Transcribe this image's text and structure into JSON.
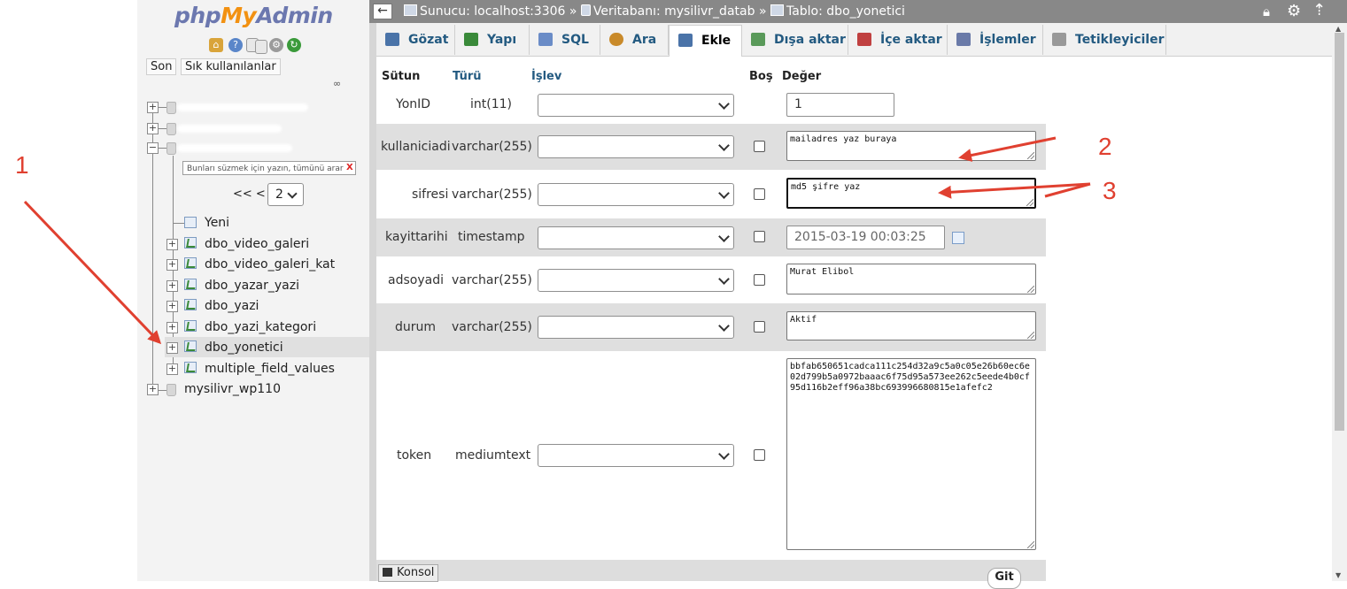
{
  "app": {
    "logo_php": "php",
    "logo_my": "My",
    "logo_admin": "Admin"
  },
  "nav": {
    "tabs": [
      "Son",
      "Sık kullanılanlar"
    ],
    "filter_placeholder": "Bunları süzmek için yazın, tümünü arar",
    "filter_clear": "X",
    "pager_prev": "<< <",
    "pager_page": "2",
    "tree_items": [
      "Yeni",
      "dbo_video_galeri",
      "dbo_video_galeri_kat",
      "dbo_yazar_yazi",
      "dbo_yazi",
      "dbo_yazi_kategori",
      "dbo_yonetici",
      "multiple_field_values"
    ],
    "db_bottom": "mysilivr_wp110"
  },
  "topbar": {
    "back": "←",
    "server": "Sunucu: localhost:3306",
    "database": "Veritabanı: mysilivr_datab",
    "table": "Tablo: dbo_yonetici",
    "sep": "»"
  },
  "tabs": [
    {
      "label": "Gözat",
      "icon": "browse-icon",
      "color": "#4a73a8"
    },
    {
      "label": "Yapı",
      "icon": "structure-icon",
      "color": "#3a8a3a"
    },
    {
      "label": "SQL",
      "icon": "sql-icon",
      "color": "#6a8cc7"
    },
    {
      "label": "Ara",
      "icon": "search-icon",
      "color": "#c98a2a"
    },
    {
      "label": "Ekle",
      "icon": "insert-icon",
      "color": "#4a73a8"
    },
    {
      "label": "Dışa aktar",
      "icon": "export-icon",
      "color": "#5a9a5a"
    },
    {
      "label": "İçe aktar",
      "icon": "import-icon",
      "color": "#c04040"
    },
    {
      "label": "İşlemler",
      "icon": "wrench-icon",
      "color": "#6a7aa8"
    },
    {
      "label": "Tetikleyiciler",
      "icon": "triggers-icon",
      "color": "#999999"
    }
  ],
  "table": {
    "headers": {
      "column": "Sütun",
      "type": "Türü",
      "function": "İşlev",
      "null": "Boş",
      "value": "Değer"
    },
    "rows": [
      {
        "name": "YonID",
        "type": "int(11)",
        "value": "1"
      },
      {
        "name": "kullaniciadi",
        "type": "varchar(255)",
        "value": "mailadres yaz buraya"
      },
      {
        "name": "sifresi",
        "type": "varchar(255)",
        "value": "md5 şifre yaz"
      },
      {
        "name": "kayittarihi",
        "type": "timestamp",
        "value": "2015-03-19 00:03:25"
      },
      {
        "name": "adsoyadi",
        "type": "varchar(255)",
        "value": "Murat Elibol"
      },
      {
        "name": "durum",
        "type": "varchar(255)",
        "value": "Aktif"
      },
      {
        "name": "token",
        "type": "mediumtext",
        "value": "bbfab650651cadca111c254d32a9c5a0c05e26b60ec6e02d799b5a0972baaac6f75d95a573ee262c5eede4b0cf95d116b2eff96a38bc693996680815e1afefc2"
      }
    ]
  },
  "console_label": "Konsol",
  "go_button": "Git",
  "annotations": [
    "1",
    "2",
    "3"
  ],
  "annotation_color": "#e04030"
}
